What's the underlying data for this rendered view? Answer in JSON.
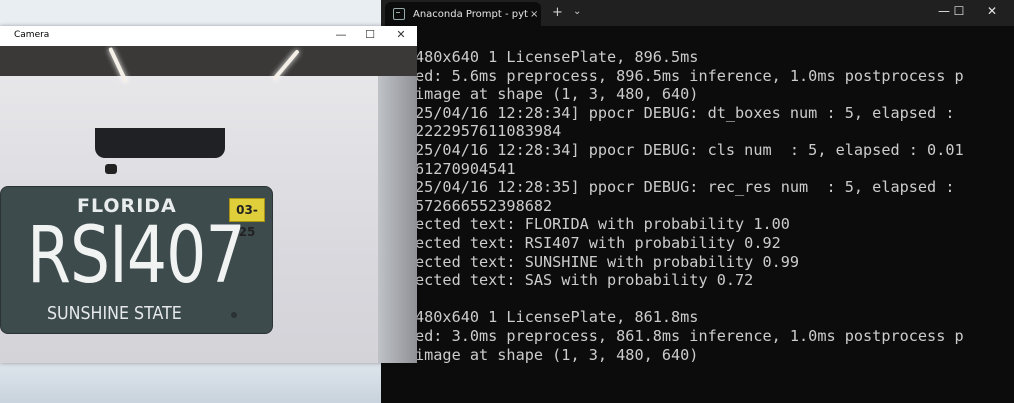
{
  "terminal": {
    "tab_title": "Anaconda Prompt - python  li",
    "tab_close": "×",
    "new_tab": "+",
    "dropdown": "⌄",
    "minimize": "—",
    "maximize": "☐",
    "close": "✕",
    "lines": [
      "480x640 1 LicensePlate, 896.5ms",
      "ed: 5.6ms preprocess, 896.5ms inference, 1.0ms postprocess p",
      "image at shape (1, 3, 480, 640)",
      "25/04/16 12:28:34] ppocr DEBUG: dt_boxes num : 5, elapsed :",
      "2222957611083984",
      "25/04/16 12:28:34] ppocr DEBUG: cls num  : 5, elapsed : 0.01",
      "61270904541",
      "25/04/16 12:28:35] ppocr DEBUG: rec_res num  : 5, elapsed :",
      "572666552398682",
      "ected text: FLORIDA with probability 1.00",
      "ected text: RSI407 with probability 0.92",
      "ected text: SUNSHINE with probability 0.99",
      "ected text: SAS with probability 0.72",
      "",
      "480x640 1 LicensePlate, 861.8ms",
      "ed: 3.0ms preprocess, 861.8ms inference, 1.0ms postprocess p",
      "image at shape (1, 3, 480, 640)"
    ]
  },
  "camera": {
    "title": "Camera",
    "minimize": "—",
    "maximize": "☐",
    "close": "✕",
    "plate": {
      "state": "FLORIDA",
      "sticker": "03-25",
      "number": "RSI407",
      "slogan": "SUNSHINE STATE"
    }
  },
  "colors": {
    "terminal_bg": "#0c0c0c",
    "terminal_text": "#cccccc",
    "plate_bg": "#3d4b4d",
    "sticker": "#e0cf3a"
  }
}
